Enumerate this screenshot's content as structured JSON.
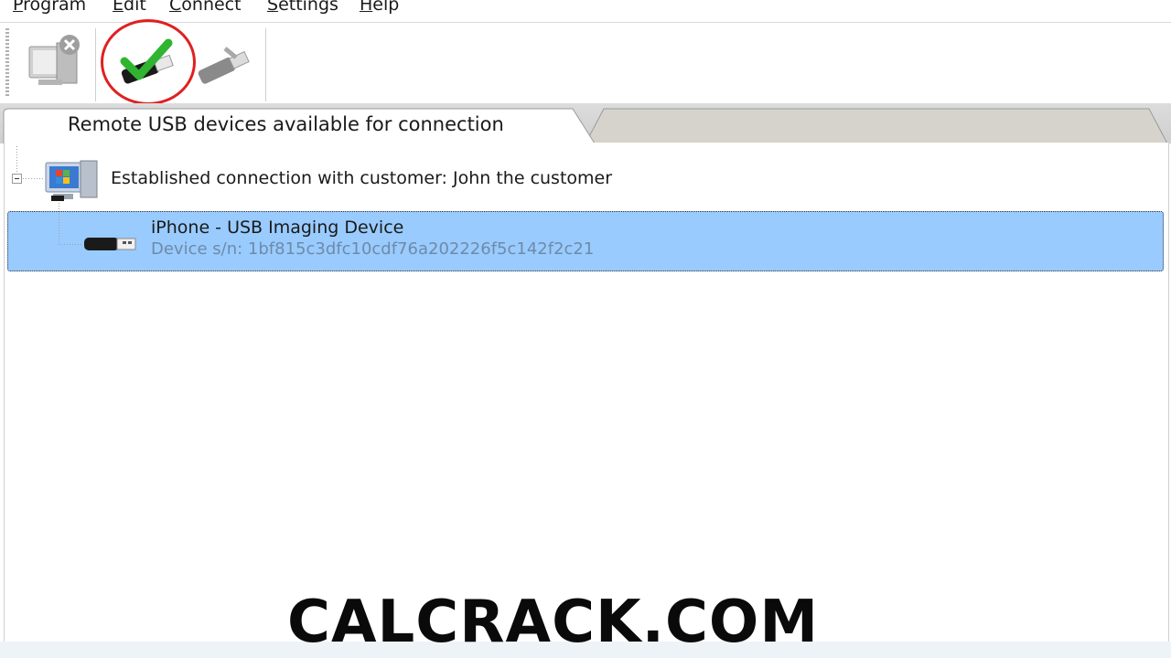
{
  "menu": {
    "items": [
      {
        "first": "P",
        "rest": "rogram"
      },
      {
        "first": "E",
        "rest": "dit"
      },
      {
        "first": "C",
        "rest": "onnect"
      },
      {
        "first": "S",
        "rest": "ettings"
      },
      {
        "first": "H",
        "rest": "elp"
      }
    ]
  },
  "toolbar": {
    "buttons": [
      {
        "icon": "disconnect-computer-icon"
      },
      {
        "icon": "connect-usb-icon"
      },
      {
        "icon": "disconnect-usb-icon"
      }
    ]
  },
  "tabs": {
    "active_label": "Remote USB devices available for connection",
    "inactive_label": ""
  },
  "tree": {
    "connection_label": "Established connection with customer: John the customer",
    "device": {
      "name": "iPhone - USB Imaging Device",
      "serial": "Device s/n: 1bf815c3dfc10cdf76a202226f5c142f2c21"
    }
  },
  "watermark": "CALCRACK.COM",
  "colors": {
    "selection": "#99cbff",
    "highlight_ring": "#e02020",
    "check_green": "#2fb52f"
  }
}
